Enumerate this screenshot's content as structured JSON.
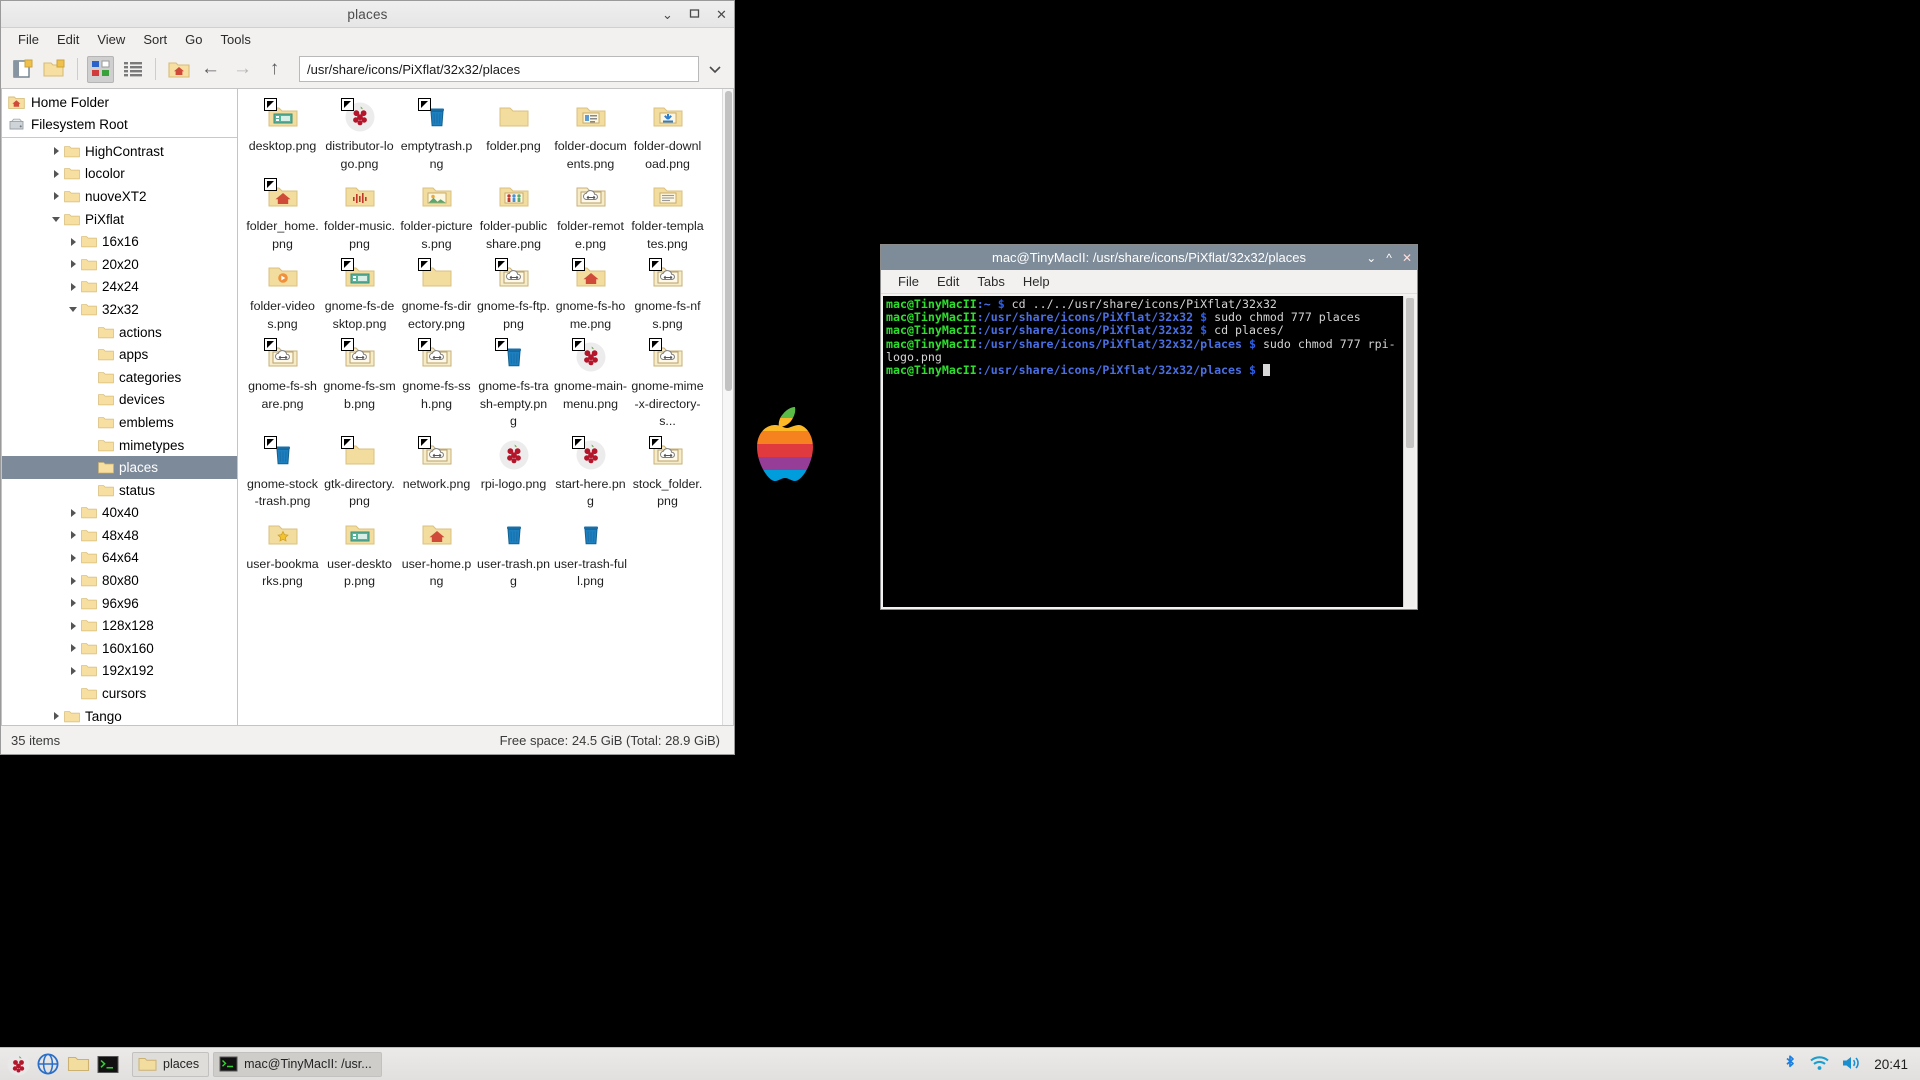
{
  "desktop": {
    "logo_name": "apple-rainbow-logo"
  },
  "filemanager": {
    "title": "places",
    "window_buttons": {
      "minimize": "⌄",
      "maximize": "▭",
      "close": "✕"
    },
    "menus": [
      "File",
      "Edit",
      "View",
      "Sort",
      "Go",
      "Tools"
    ],
    "toolbar": {
      "new_tab": "new-tab-icon",
      "new_folder": "new-folder-icon",
      "icon_view": "icon-view-icon",
      "list_view": "list-view-icon",
      "home": "home-icon",
      "back": "←",
      "forward": "→",
      "up": "↑",
      "path": "/usr/share/icons/PiXflat/32x32/places",
      "path_dropdown": "chevron-down-icon"
    },
    "places": [
      {
        "label": "Home Folder",
        "icon": "home-folder-icon"
      },
      {
        "label": "Filesystem Root",
        "icon": "drive-icon"
      }
    ],
    "tree": [
      {
        "label": "HighContrast",
        "indent": 1,
        "twisty": "right",
        "selected": false
      },
      {
        "label": "locolor",
        "indent": 1,
        "twisty": "right",
        "selected": false
      },
      {
        "label": "nuoveXT2",
        "indent": 1,
        "twisty": "right",
        "selected": false
      },
      {
        "label": "PiXflat",
        "indent": 1,
        "twisty": "down",
        "selected": false
      },
      {
        "label": "16x16",
        "indent": 2,
        "twisty": "right",
        "selected": false
      },
      {
        "label": "20x20",
        "indent": 2,
        "twisty": "right",
        "selected": false
      },
      {
        "label": "24x24",
        "indent": 2,
        "twisty": "right",
        "selected": false
      },
      {
        "label": "32x32",
        "indent": 2,
        "twisty": "down",
        "selected": false
      },
      {
        "label": "actions",
        "indent": 3,
        "twisty": "none",
        "selected": false
      },
      {
        "label": "apps",
        "indent": 3,
        "twisty": "none",
        "selected": false
      },
      {
        "label": "categories",
        "indent": 3,
        "twisty": "none",
        "selected": false
      },
      {
        "label": "devices",
        "indent": 3,
        "twisty": "none",
        "selected": false
      },
      {
        "label": "emblems",
        "indent": 3,
        "twisty": "none",
        "selected": false
      },
      {
        "label": "mimetypes",
        "indent": 3,
        "twisty": "none",
        "selected": false
      },
      {
        "label": "places",
        "indent": 3,
        "twisty": "none",
        "selected": true
      },
      {
        "label": "status",
        "indent": 3,
        "twisty": "none",
        "selected": false
      },
      {
        "label": "40x40",
        "indent": 2,
        "twisty": "right",
        "selected": false
      },
      {
        "label": "48x48",
        "indent": 2,
        "twisty": "right",
        "selected": false
      },
      {
        "label": "64x64",
        "indent": 2,
        "twisty": "right",
        "selected": false
      },
      {
        "label": "80x80",
        "indent": 2,
        "twisty": "right",
        "selected": false
      },
      {
        "label": "96x96",
        "indent": 2,
        "twisty": "right",
        "selected": false
      },
      {
        "label": "128x128",
        "indent": 2,
        "twisty": "right",
        "selected": false
      },
      {
        "label": "160x160",
        "indent": 2,
        "twisty": "right",
        "selected": false
      },
      {
        "label": "192x192",
        "indent": 2,
        "twisty": "right",
        "selected": false
      },
      {
        "label": "cursors",
        "indent": 2,
        "twisty": "none",
        "selected": false
      },
      {
        "label": "Tango",
        "indent": 1,
        "twisty": "right",
        "selected": false
      }
    ],
    "files": [
      {
        "name": "desktop.png",
        "icon": "folder-desktop",
        "link": true
      },
      {
        "name": "distributor-logo.png",
        "icon": "raspberry",
        "link": true
      },
      {
        "name": "emptytrash.png",
        "icon": "trash-blue",
        "link": true
      },
      {
        "name": "folder.png",
        "icon": "folder-plain",
        "link": false
      },
      {
        "name": "folder-documents.png",
        "icon": "folder-documents",
        "link": false
      },
      {
        "name": "folder-download.png",
        "icon": "folder-download",
        "link": false
      },
      {
        "name": "folder_home.png",
        "icon": "folder-home",
        "link": true
      },
      {
        "name": "folder-music.png",
        "icon": "folder-music",
        "link": false
      },
      {
        "name": "folder-pictures.png",
        "icon": "folder-pictures",
        "link": false
      },
      {
        "name": "folder-publicshare.png",
        "icon": "folder-publicshare",
        "link": false
      },
      {
        "name": "folder-remote.png",
        "icon": "folder-remote",
        "link": false
      },
      {
        "name": "folder-templates.png",
        "icon": "folder-templates",
        "link": false
      },
      {
        "name": "folder-videos.png",
        "icon": "folder-videos",
        "link": false
      },
      {
        "name": "gnome-fs-desktop.png",
        "icon": "folder-desktop",
        "link": true
      },
      {
        "name": "gnome-fs-directory.png",
        "icon": "folder-plain",
        "link": true
      },
      {
        "name": "gnome-fs-ftp.png",
        "icon": "folder-remote",
        "link": true
      },
      {
        "name": "gnome-fs-home.png",
        "icon": "folder-home",
        "link": true
      },
      {
        "name": "gnome-fs-nfs.png",
        "icon": "folder-remote",
        "link": true
      },
      {
        "name": "gnome-fs-share.png",
        "icon": "folder-remote",
        "link": true
      },
      {
        "name": "gnome-fs-smb.png",
        "icon": "folder-remote",
        "link": true
      },
      {
        "name": "gnome-fs-ssh.png",
        "icon": "folder-remote",
        "link": true
      },
      {
        "name": "gnome-fs-trash-empty.png",
        "icon": "trash-blue",
        "link": true
      },
      {
        "name": "gnome-main-menu.png",
        "icon": "raspberry",
        "link": true
      },
      {
        "name": "gnome-mime-x-directory-s...",
        "icon": "folder-remote",
        "link": true
      },
      {
        "name": "gnome-stock-trash.png",
        "icon": "trash-blue",
        "link": true
      },
      {
        "name": "gtk-directory.png",
        "icon": "folder-plain",
        "link": true
      },
      {
        "name": "network.png",
        "icon": "folder-remote",
        "link": true
      },
      {
        "name": "rpi-logo.png",
        "icon": "raspberry",
        "link": false
      },
      {
        "name": "start-here.png",
        "icon": "raspberry",
        "link": true
      },
      {
        "name": "stock_folder.png",
        "icon": "folder-remote",
        "link": true
      },
      {
        "name": "user-bookmarks.png",
        "icon": "folder-bookmarks",
        "link": false
      },
      {
        "name": "user-desktop.png",
        "icon": "folder-desktop",
        "link": false
      },
      {
        "name": "user-home.png",
        "icon": "folder-home",
        "link": false
      },
      {
        "name": "user-trash.png",
        "icon": "trash-blue",
        "link": false
      },
      {
        "name": "user-trash-full.png",
        "icon": "trash-blue",
        "link": false
      }
    ],
    "status": {
      "items": "35 items",
      "freespace": "Free space: 24.5 GiB (Total: 28.9 GiB)"
    }
  },
  "terminal": {
    "title": "mac@TinyMacII: /usr/share/icons/PiXflat/32x32/places",
    "window_buttons": {
      "minimize": "⌄",
      "maximize": "^",
      "close": "✕"
    },
    "menus": [
      "File",
      "Edit",
      "Tabs",
      "Help"
    ],
    "lines": [
      {
        "user": "mac@TinyMacII",
        "path": ":~",
        "prompt": "$",
        "cmd": " cd ../../usr/share/icons/PiXflat/32x32"
      },
      {
        "user": "mac@TinyMacII",
        "path": ":/usr/share/icons/PiXflat/32x32",
        "prompt": "$",
        "cmd": " sudo chmod 777 places"
      },
      {
        "user": "mac@TinyMacII",
        "path": ":/usr/share/icons/PiXflat/32x32",
        "prompt": "$",
        "cmd": " cd places/"
      },
      {
        "user": "mac@TinyMacII",
        "path": ":/usr/share/icons/PiXflat/32x32/places",
        "prompt": "$",
        "cmd": " sudo chmod 777 rpi-logo.png"
      },
      {
        "user": "mac@TinyMacII",
        "path": ":/usr/share/icons/PiXflat/32x32/places",
        "prompt": "$",
        "cmd": " "
      }
    ]
  },
  "taskbar": {
    "launchers": [
      {
        "name": "raspberry-menu-icon"
      },
      {
        "name": "web-browser-icon"
      },
      {
        "name": "file-manager-icon"
      },
      {
        "name": "terminal-icon"
      }
    ],
    "tasks": [
      {
        "label": "places",
        "icon": "folder-icon",
        "active": false
      },
      {
        "label": "mac@TinyMacII: /usr...",
        "icon": "terminal-icon",
        "active": true
      }
    ],
    "tray": [
      {
        "name": "bluetooth-icon"
      },
      {
        "name": "wifi-icon"
      },
      {
        "name": "volume-icon"
      }
    ],
    "clock": "20:41"
  }
}
